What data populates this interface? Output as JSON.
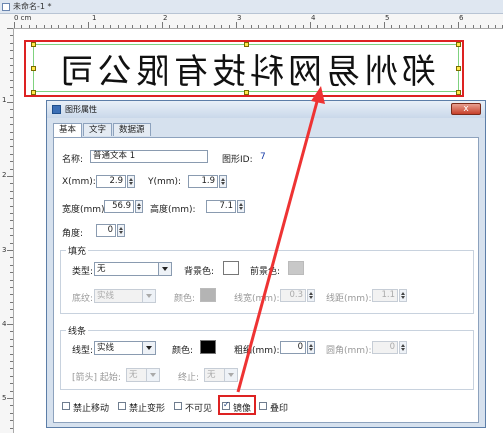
{
  "window": {
    "doc_tab_title": "未命名-1 *"
  },
  "rulers": {
    "top_labels": [
      "0 cm",
      "1",
      "2",
      "3",
      "4",
      "5",
      "6"
    ],
    "left_labels": [
      "1",
      "2",
      "3",
      "4",
      "5"
    ]
  },
  "label": {
    "text": "郑州易网科技有限公司",
    "mirrored": true
  },
  "dialog": {
    "title": "图形属性",
    "close_label": "x",
    "tabs": [
      {
        "label": "基本"
      },
      {
        "label": "文字"
      },
      {
        "label": "数据源"
      }
    ],
    "basic": {
      "name_label": "名称:",
      "name_value": "普通文本 1",
      "id_label": "图形ID:",
      "id_value": "7",
      "x_label": "X(mm):",
      "x_value": "2.9",
      "y_label": "Y(mm):",
      "y_value": "1.9",
      "width_label": "宽度(mm):",
      "width_value": "56.9",
      "height_label": "高度(mm):",
      "height_value": "7.1",
      "angle_label": "角度:",
      "angle_value": "0"
    },
    "fill": {
      "group_label": "填充",
      "type_label": "类型:",
      "type_value": "无",
      "bg_label": "背景色:",
      "bg_color": "#ffffff",
      "fg_label": "前景色:",
      "fg_color": "#c8c8c8",
      "texture_label": "底纹:",
      "texture_value": "实线",
      "color_label": "颜色:",
      "color_value": "#b4b4b4",
      "line_width_label": "线宽(mm):",
      "line_width_value": "0.3",
      "line_spacing_label": "线距(mm):",
      "line_spacing_value": "1.1"
    },
    "stroke": {
      "group_label": "线条",
      "type_label": "线型:",
      "type_value": "实线",
      "color_label": "颜色:",
      "color_value": "#000000",
      "thickness_label": "粗细(mm):",
      "thickness_value": "0",
      "corner_label": "圆角(mm):",
      "corner_value": "0",
      "arrow_label": "[箭头] 起始:",
      "arrow_start_value": "无",
      "arrow_end_label": "终止:",
      "arrow_end_value": "无"
    },
    "options": [
      {
        "label": "禁止移动",
        "checked": false
      },
      {
        "label": "禁止变形",
        "checked": false
      },
      {
        "label": "不可见",
        "checked": false
      },
      {
        "label": "镜像",
        "checked": true
      },
      {
        "label": "叠印",
        "checked": false
      }
    ]
  },
  "colors": {
    "highlight": "#dd2222",
    "arrow": "#ee3333",
    "selection": "#7fd27f"
  }
}
